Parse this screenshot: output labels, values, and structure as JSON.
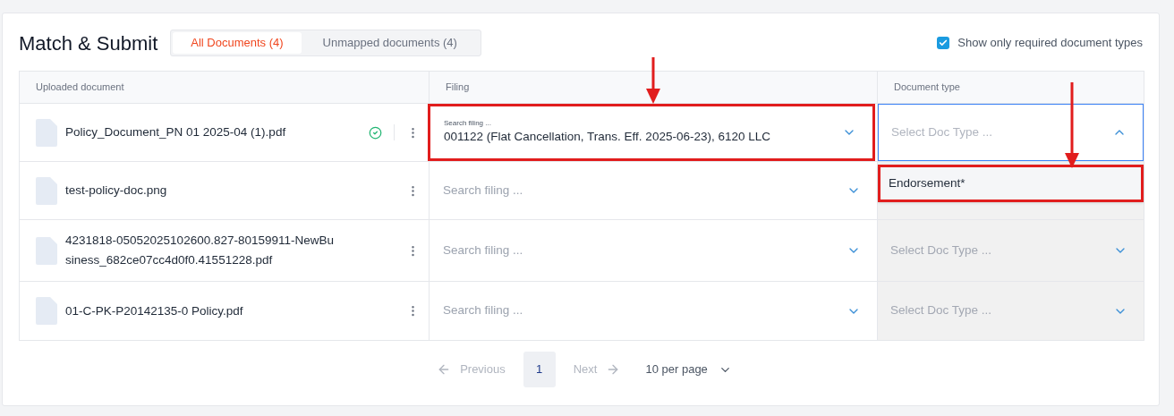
{
  "title": "Match & Submit",
  "tabs": [
    {
      "label": "All Documents (4)",
      "selected": true
    },
    {
      "label": "Unmapped documents (4)",
      "selected": false
    }
  ],
  "required_only": {
    "label": "Show only required document types",
    "checked": true
  },
  "table": {
    "columns": [
      "Uploaded document",
      "Filing",
      "Document type"
    ],
    "rows": [
      {
        "document": "Policy_Document_PN 01 2025-04 (1).pdf",
        "verified": true,
        "filing": {
          "label": "Search filing ...",
          "value": "001122 (Flat Cancellation, Trans. Eff. 2025-06-23), 6120 LLC",
          "highlighted": true
        },
        "doc_type": {
          "placeholder": "Select Doc Type ...",
          "open": true,
          "disabled": false,
          "options": [
            {
              "label": "Endorsement*",
              "highlighted": true
            }
          ]
        }
      },
      {
        "document": "test-policy-doc.png",
        "verified": false,
        "filing": {
          "placeholder": "Search filing ...",
          "highlighted": false
        }
      },
      {
        "document": "4231818-05052025102600.827-80159911-NewBusiness_682ce07cc4d0f0.41551228.pdf",
        "verified": false,
        "filing": {
          "placeholder": "Search filing ...",
          "highlighted": false
        },
        "doc_type": {
          "placeholder": "Select Doc Type ...",
          "open": false,
          "disabled": true
        }
      },
      {
        "document": "01-C-PK-P20142135-0 Policy.pdf",
        "verified": false,
        "filing": {
          "placeholder": "Search filing ...",
          "highlighted": false
        },
        "doc_type": {
          "placeholder": "Select Doc Type ...",
          "open": false,
          "disabled": true
        }
      }
    ]
  },
  "pagination": {
    "previous": {
      "label": "Previous",
      "disabled": true
    },
    "pages": [
      {
        "label": "1",
        "selected": true
      }
    ],
    "next": {
      "label": "Next",
      "disabled": true
    },
    "page_size": "10 per page"
  }
}
